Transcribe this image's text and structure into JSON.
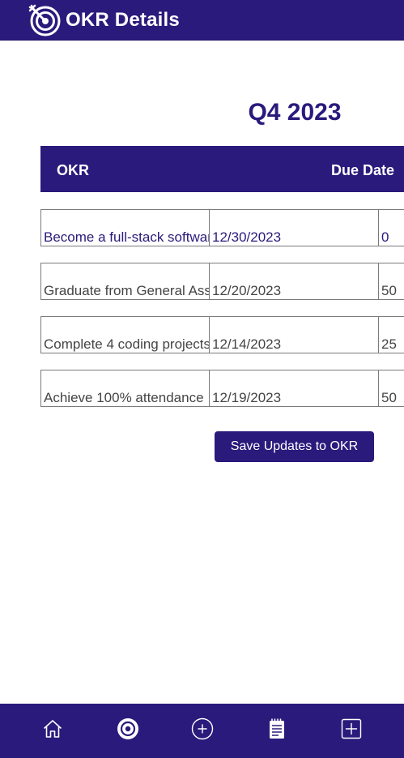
{
  "header": {
    "title": "OKR Details",
    "logo_icon": "target-arrow-icon"
  },
  "quarter": "Q4 2023",
  "table": {
    "columns": [
      "OKR",
      "Due Date"
    ],
    "rows": [
      {
        "okr": "Become a full-stack software engineer",
        "due_date": "12/30/2023",
        "progress": "0"
      },
      {
        "okr": "Graduate from General Assembly",
        "due_date": "12/20/2023",
        "progress": "50"
      },
      {
        "okr": "Complete 4 coding projects",
        "due_date": "12/14/2023",
        "progress": "25"
      },
      {
        "okr": "Achieve 100% attendance",
        "due_date": "12/19/2023",
        "progress": "50"
      }
    ]
  },
  "save_button": "Save Updates to OKR",
  "bottom_nav": [
    {
      "icon": "home-icon"
    },
    {
      "icon": "target-icon",
      "active": true
    },
    {
      "icon": "add-circle-icon"
    },
    {
      "icon": "notepad-icon"
    },
    {
      "icon": "add-square-icon"
    }
  ],
  "colors": {
    "primary": "#2a1a7c",
    "background": "#ffffff",
    "text": "#444444"
  }
}
